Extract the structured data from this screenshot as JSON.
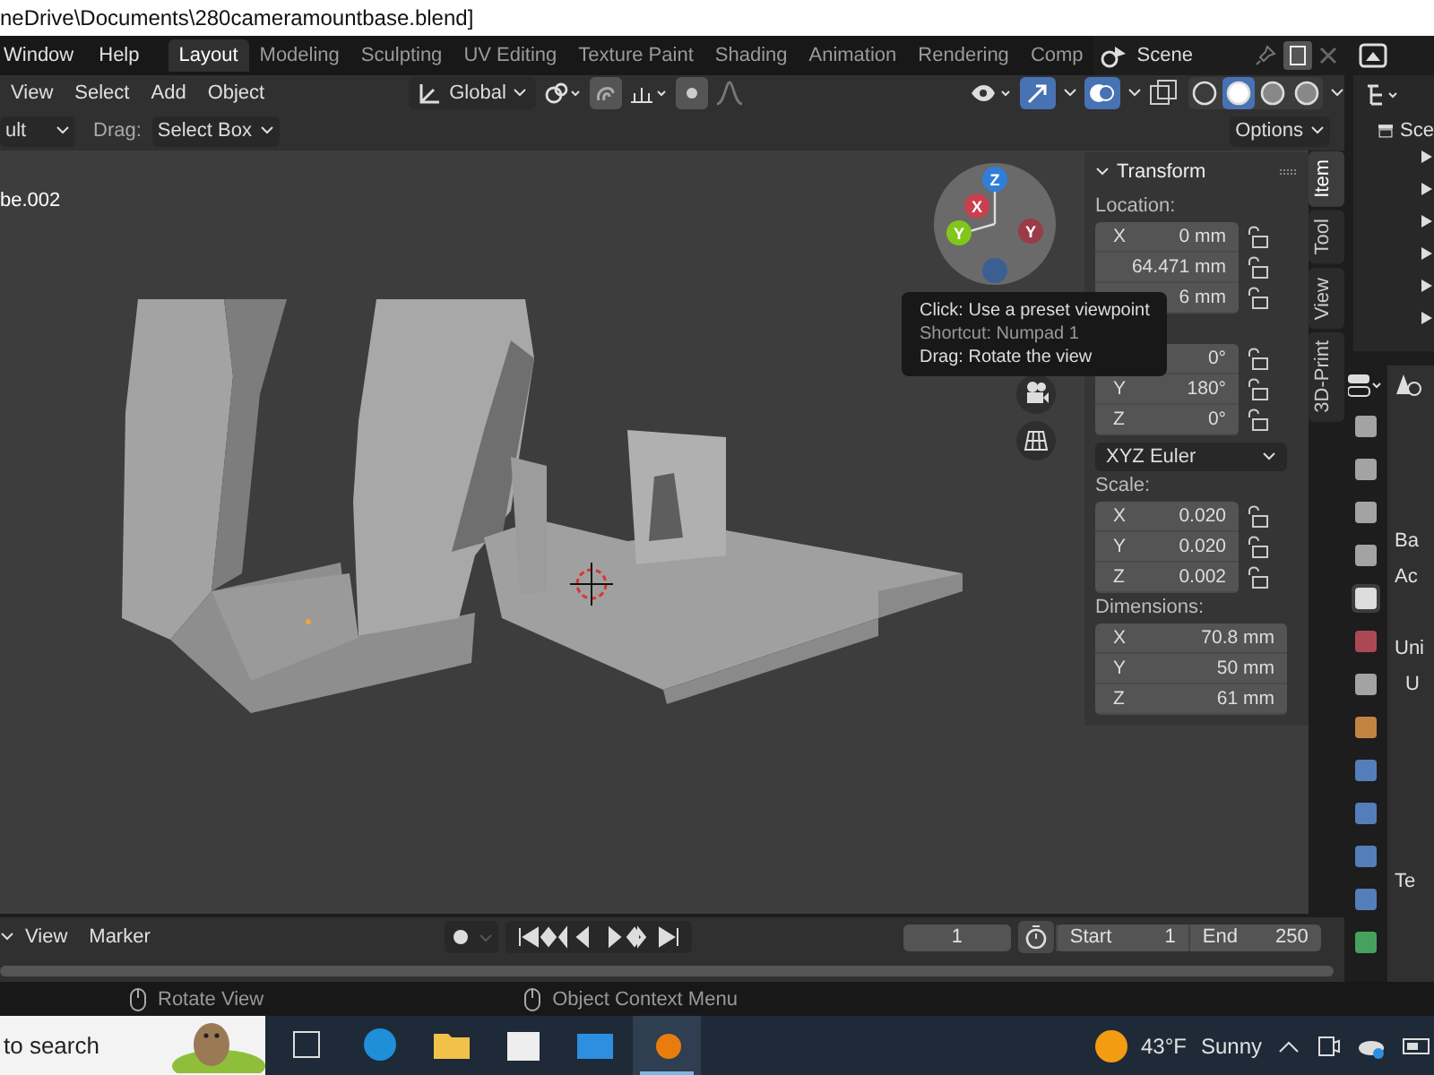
{
  "title_bar": {
    "title": "neDrive\\Documents\\280cameramountbase.blend]"
  },
  "top_bar": {
    "menus": [
      "Window",
      "Help"
    ],
    "workspaces": [
      {
        "label": "Layout",
        "selected": true
      },
      {
        "label": "Modeling",
        "selected": false
      },
      {
        "label": "Sculpting",
        "selected": false
      },
      {
        "label": "UV Editing",
        "selected": false
      },
      {
        "label": "Texture Paint",
        "selected": false
      },
      {
        "label": "Shading",
        "selected": false
      },
      {
        "label": "Animation",
        "selected": false
      },
      {
        "label": "Rendering",
        "selected": false
      },
      {
        "label": "Comp",
        "selected": false
      }
    ],
    "scene": "Scene"
  },
  "viewport_header": {
    "menus": [
      "View",
      "Select",
      "Add",
      "Object"
    ],
    "orientation": "Global",
    "shading_modes": [
      {
        "selected": false
      },
      {
        "selected": true
      },
      {
        "selected": false
      },
      {
        "selected": false
      }
    ]
  },
  "tool_settings": {
    "mode": "ult",
    "drag_label": "Drag:",
    "drag_value": "Select Box",
    "options": "Options"
  },
  "viewport": {
    "object_name": "be.002",
    "gizmo_axes": [
      {
        "label": "Z",
        "color": "#2f7fd9"
      },
      {
        "label": "X",
        "color": "#c8404e"
      },
      {
        "label": "Y",
        "color": "#82c61c"
      },
      {
        "label": "Y",
        "color": "#9a3c47"
      }
    ]
  },
  "tooltip": {
    "lines": [
      "Click: Use a preset viewpoint",
      "Shortcut: Numpad 1",
      "Drag: Rotate the view"
    ]
  },
  "sidebar": {
    "title": "Transform",
    "tabs": [
      {
        "label": "Item",
        "selected": true
      },
      {
        "label": "Tool",
        "selected": false
      },
      {
        "label": "View",
        "selected": false
      },
      {
        "label": "3D-Print",
        "selected": false
      }
    ],
    "groups": [
      {
        "label": "Location:",
        "locks": true,
        "fields": [
          {
            "axis": "X",
            "value": "0 mm"
          },
          {
            "value": "64.471 mm"
          },
          {
            "value": "6 mm"
          }
        ]
      },
      {
        "locks": true,
        "fields": [
          {
            "value": "0°"
          },
          {
            "axis": "Y",
            "value": "180°"
          },
          {
            "axis": "Z",
            "value": "0°"
          }
        ],
        "mode": "XYZ Euler"
      },
      {
        "label": "Scale:",
        "locks": true,
        "fields": [
          {
            "axis": "X",
            "value": "0.020"
          },
          {
            "axis": "Y",
            "value": "0.020"
          },
          {
            "axis": "Z",
            "value": "0.002"
          }
        ]
      },
      {
        "label": "Dimensions:",
        "locks": false,
        "fields": [
          {
            "axis": "X",
            "value": "70.8 mm"
          },
          {
            "axis": "Y",
            "value": "50 mm"
          },
          {
            "axis": "Z",
            "value": "61 mm"
          }
        ]
      }
    ]
  },
  "outliner": {
    "root": "Sce"
  },
  "properties": {
    "texts": [
      "Ba",
      "Ac",
      "Uni",
      "U",
      "Te"
    ]
  },
  "timeline": {
    "menus": [
      "View",
      "Marker"
    ],
    "current_frame": "1",
    "start_label": "Start",
    "start": "1",
    "end_label": "End",
    "end": "250"
  },
  "status_bar": {
    "hints": [
      "Rotate View",
      "Object Context Menu"
    ]
  },
  "taskbar": {
    "search": "to search",
    "apps": [
      {
        "selected": false
      },
      {
        "selected": false
      },
      {
        "selected": false
      },
      {
        "selected": false
      },
      {
        "selected": false
      },
      {
        "selected": true
      }
    ],
    "temperature": "43°F",
    "weather": "Sunny"
  }
}
